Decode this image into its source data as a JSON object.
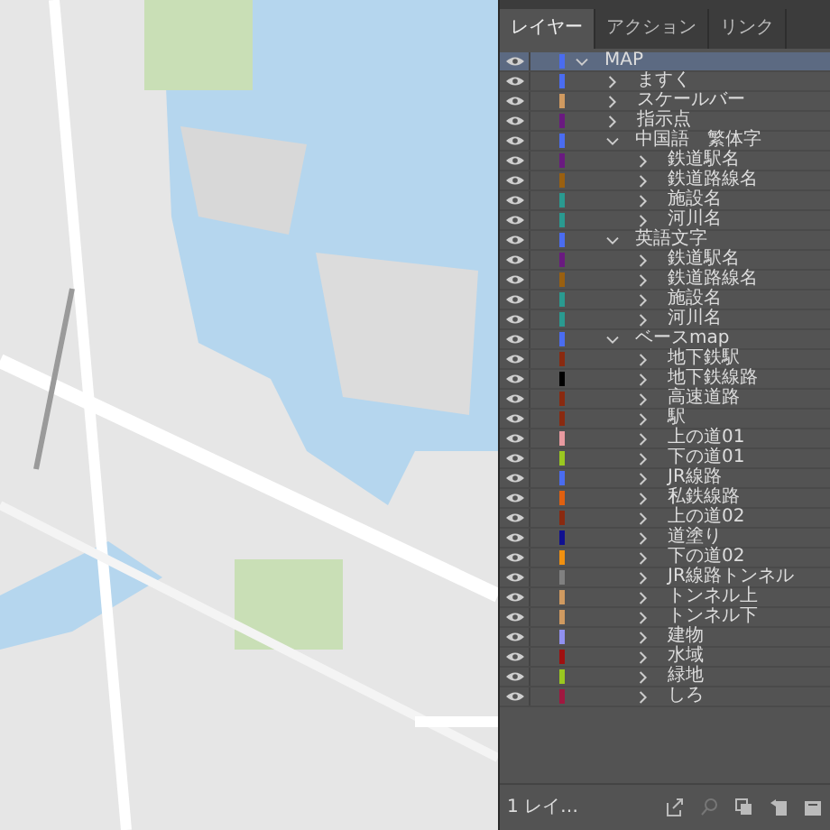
{
  "tabs": [
    {
      "label": "レイヤー",
      "selected": true
    },
    {
      "label": "アクション",
      "selected": false
    },
    {
      "label": "リンク",
      "selected": false
    }
  ],
  "layers": [
    {
      "name": "MAP",
      "color": "#4a6cf0",
      "expanded": true,
      "selected": true,
      "children": [
        {
          "name": "ますく",
          "color": "#4a6cf0",
          "expanded": false,
          "selected": false
        },
        {
          "name": "スケールバー",
          "color": "#d09a60",
          "expanded": false,
          "selected": false
        },
        {
          "name": "指示点",
          "color": "#6a1a80",
          "expanded": false,
          "selected": false
        },
        {
          "name": "中国語　繁体字",
          "color": "#4a6cf0",
          "expanded": true,
          "selected": false,
          "children": [
            {
              "name": "鉄道駅名",
              "color": "#6a1a80",
              "expanded": false,
              "selected": false
            },
            {
              "name": "鉄道路線名",
              "color": "#9a6010",
              "expanded": false,
              "selected": false
            },
            {
              "name": "施設名",
              "color": "#2a9a90",
              "expanded": false,
              "selected": false
            },
            {
              "name": "河川名",
              "color": "#2a9a90",
              "expanded": false,
              "selected": false
            }
          ]
        },
        {
          "name": "英語文字",
          "color": "#4a6cf0",
          "expanded": true,
          "selected": false,
          "children": [
            {
              "name": "鉄道駅名",
              "color": "#6a1a80",
              "expanded": false,
              "selected": false
            },
            {
              "name": "鉄道路線名",
              "color": "#9a6010",
              "expanded": false,
              "selected": false
            },
            {
              "name": "施設名",
              "color": "#2a9a90",
              "expanded": false,
              "selected": false
            },
            {
              "name": "河川名",
              "color": "#2a9a90",
              "expanded": false,
              "selected": false
            }
          ]
        },
        {
          "name": "ベースmap",
          "color": "#4a6cf0",
          "expanded": true,
          "selected": false,
          "children": [
            {
              "name": "地下鉄駅",
              "color": "#8a2a10",
              "expanded": false,
              "selected": false
            },
            {
              "name": "地下鉄線路",
              "color": "#000000",
              "expanded": false,
              "selected": false
            },
            {
              "name": "高速道路",
              "color": "#8a2a10",
              "expanded": false,
              "selected": false
            },
            {
              "name": "駅",
              "color": "#8a2a10",
              "expanded": false,
              "selected": false
            },
            {
              "name": "上の道01",
              "color": "#e89aa0",
              "expanded": false,
              "selected": false
            },
            {
              "name": "下の道01",
              "color": "#9ac820",
              "expanded": false,
              "selected": false
            },
            {
              "name": "JR線路",
              "color": "#4a6cf0",
              "expanded": false,
              "selected": false
            },
            {
              "name": "私鉄線路",
              "color": "#e06010",
              "expanded": false,
              "selected": false
            },
            {
              "name": "上の道02",
              "color": "#8a2a10",
              "expanded": false,
              "selected": false
            },
            {
              "name": "道塗り",
              "color": "#101090",
              "expanded": false,
              "selected": false
            },
            {
              "name": "下の道02",
              "color": "#f09010",
              "expanded": false,
              "selected": false
            },
            {
              "name": "JR線路トンネル",
              "color": "#808080",
              "expanded": false,
              "selected": false
            },
            {
              "name": "トンネル上",
              "color": "#d09a60",
              "expanded": false,
              "selected": false
            },
            {
              "name": "トンネル下",
              "color": "#d09a60",
              "expanded": false,
              "selected": false
            },
            {
              "name": "建物",
              "color": "#9090f0",
              "expanded": false,
              "selected": false
            },
            {
              "name": "水域",
              "color": "#a01010",
              "expanded": false,
              "selected": false
            },
            {
              "name": "緑地",
              "color": "#9ac820",
              "expanded": false,
              "selected": false
            },
            {
              "name": "しろ",
              "color": "#a01840",
              "expanded": false,
              "selected": false
            }
          ]
        }
      ]
    }
  ],
  "status": {
    "layer_count": "1 レイ…"
  }
}
